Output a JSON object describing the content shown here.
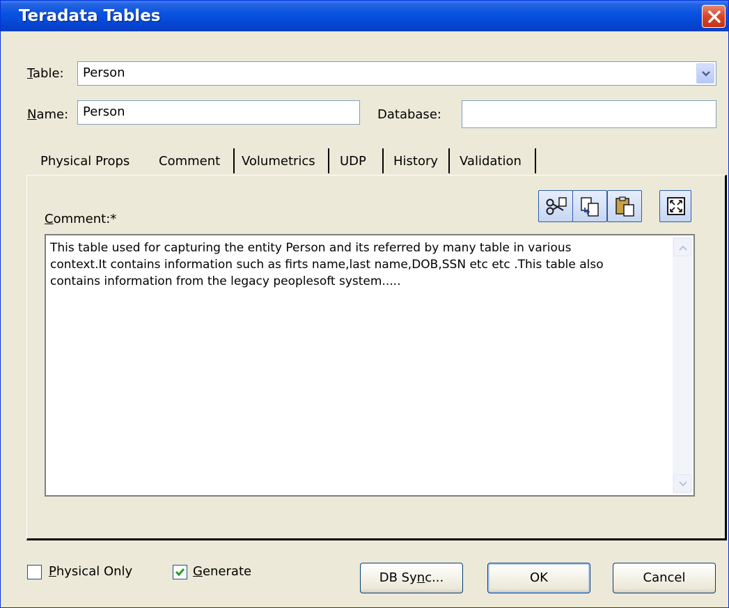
{
  "window": {
    "title": "Teradata Tables"
  },
  "form": {
    "table_label": "Table:",
    "table_value": "Person",
    "name_label": "Name:",
    "name_value": "Person",
    "database_label": "Database:",
    "database_value": ""
  },
  "tabs": [
    {
      "label": "Physical Props"
    },
    {
      "label": "Comment",
      "selected": true
    },
    {
      "label": "Volumetrics"
    },
    {
      "label": "UDP"
    },
    {
      "label": "History"
    },
    {
      "label": "Validation"
    }
  ],
  "comment": {
    "label": "Comment:*",
    "text": "This table used for capturing the entity Person and its referred by many table in various\ncontext.It contains information such as firts name,last name,DOB,SSN etc etc .This table also\ncontains information from the legacy peoplesoft system.....",
    "toolbar_icons": [
      "cut-icon",
      "copy-icon",
      "paste-icon",
      "expand-icon"
    ]
  },
  "footer": {
    "physical_only_label": "Physical Only",
    "physical_only_checked": false,
    "generate_label": "Generate",
    "generate_checked": true,
    "db_sync_label": "DB Sync...",
    "ok_label": "OK",
    "cancel_label": "Cancel"
  },
  "colors": {
    "title_bar": "#0a54e2",
    "dialog_bg": "#ece9d8",
    "close_button": "#d8452b",
    "check_mark": "#21a121"
  }
}
